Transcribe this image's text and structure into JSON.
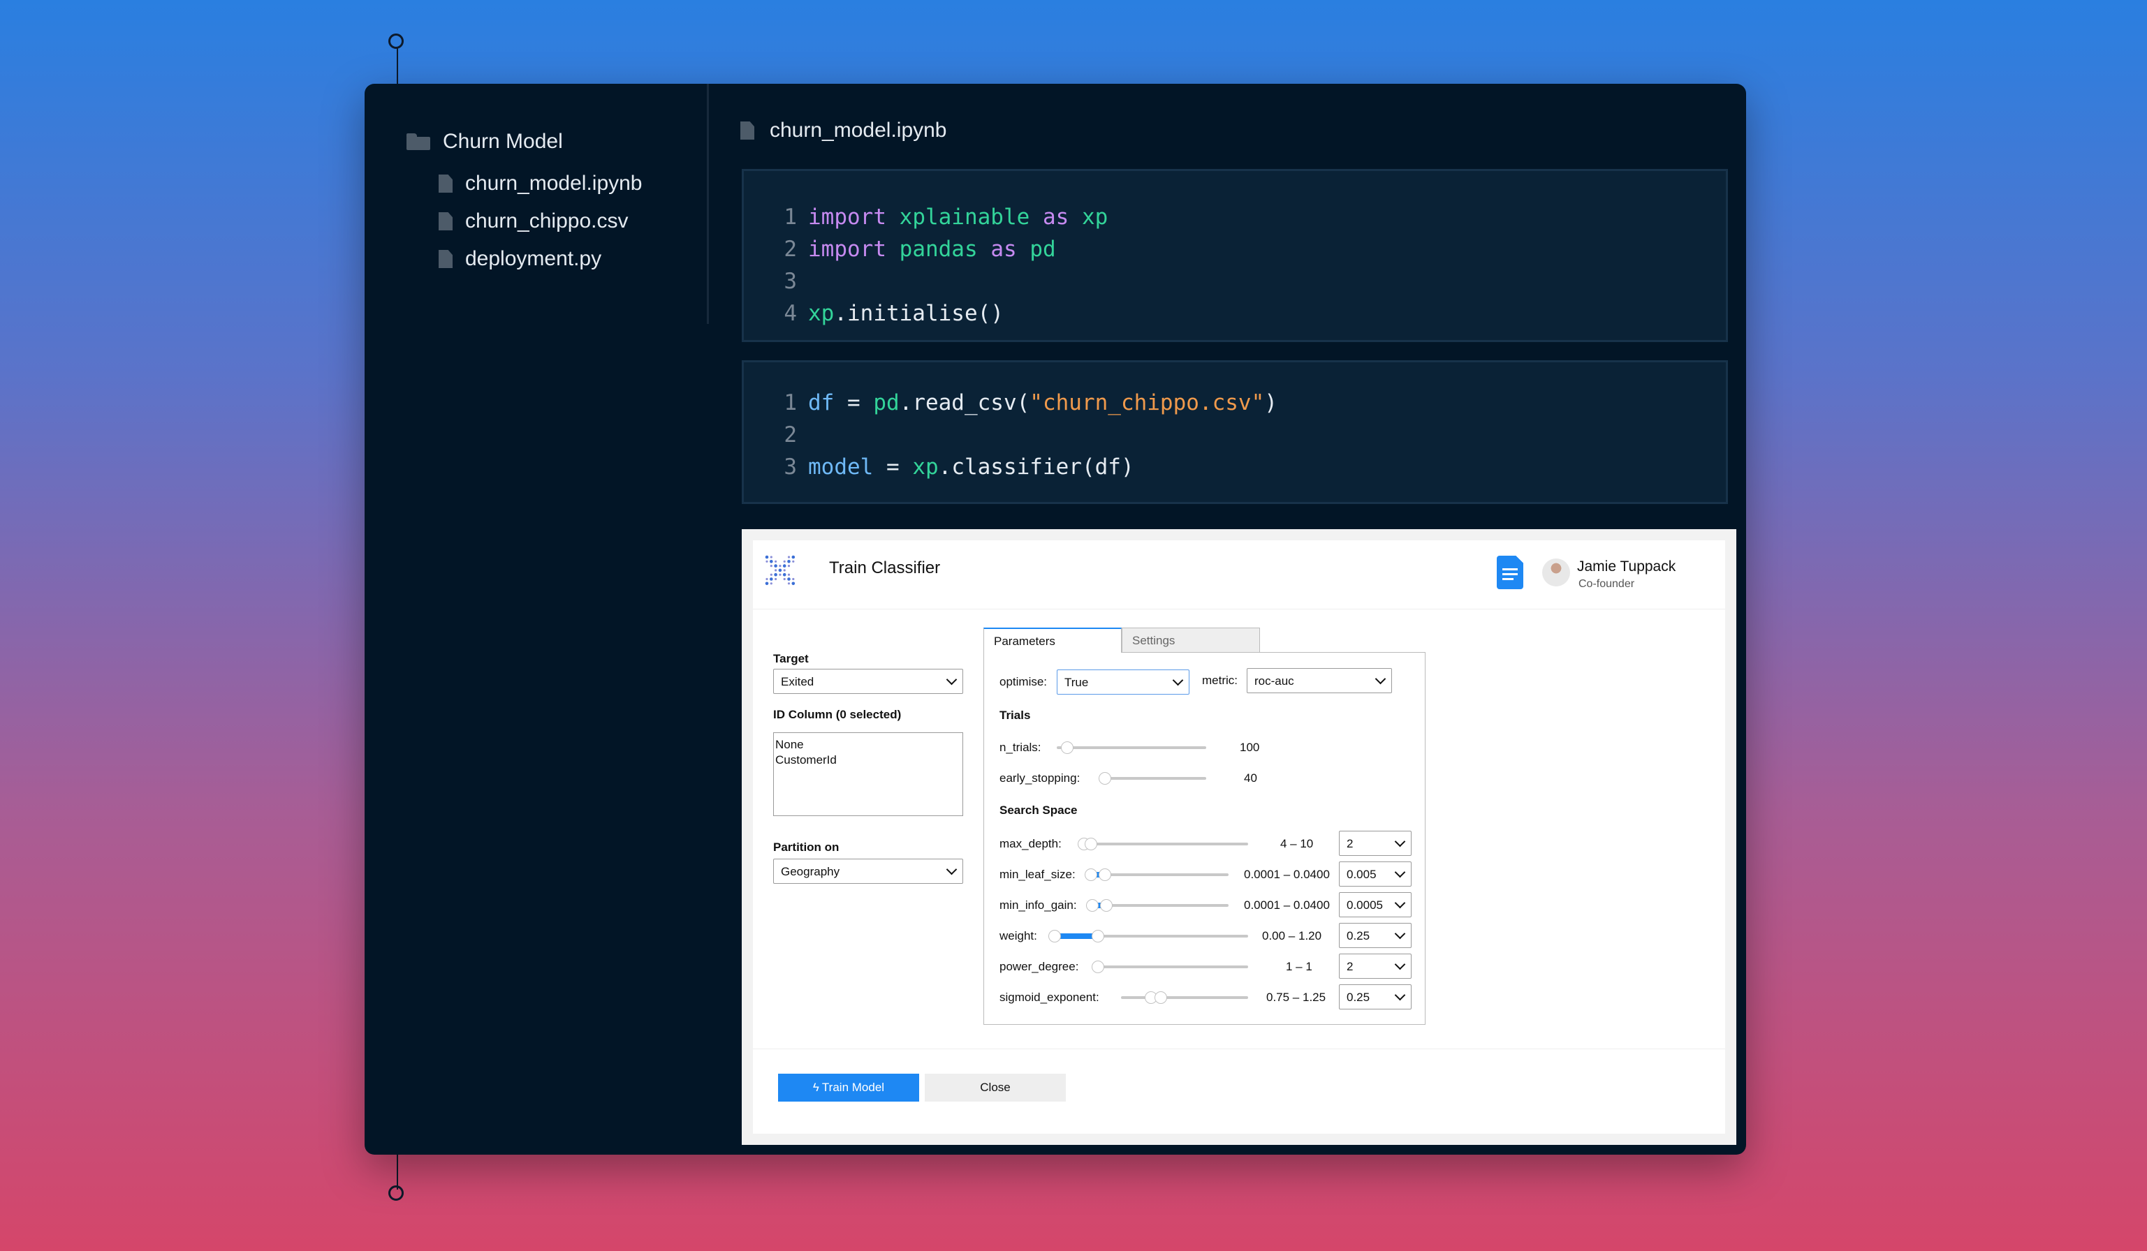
{
  "sidebar": {
    "folder": "Churn Model",
    "files": [
      "churn_model.ipynb",
      "churn_chippo.csv",
      "deployment.py"
    ]
  },
  "main": {
    "open_file": "churn_model.ipynb"
  },
  "cells": [
    {
      "lines": [
        {
          "n": "1",
          "tokens": [
            {
              "t": "import",
              "c": "kw"
            },
            {
              "t": " ",
              "c": "op"
            },
            {
              "t": "xplainable",
              "c": "mod"
            },
            {
              "t": " ",
              "c": "op"
            },
            {
              "t": "as",
              "c": "kw"
            },
            {
              "t": " ",
              "c": "op"
            },
            {
              "t": "xp",
              "c": "mod"
            }
          ]
        },
        {
          "n": "2",
          "tokens": [
            {
              "t": "import",
              "c": "kw"
            },
            {
              "t": " ",
              "c": "op"
            },
            {
              "t": "pandas",
              "c": "mod"
            },
            {
              "t": " ",
              "c": "op"
            },
            {
              "t": "as",
              "c": "kw"
            },
            {
              "t": " ",
              "c": "op"
            },
            {
              "t": "pd",
              "c": "mod"
            }
          ]
        },
        {
          "n": "3",
          "tokens": []
        },
        {
          "n": "4",
          "tokens": [
            {
              "t": "xp",
              "c": "mod"
            },
            {
              "t": ".initialise()",
              "c": "fn"
            }
          ]
        }
      ]
    },
    {
      "lines": [
        {
          "n": "1",
          "tokens": [
            {
              "t": "df",
              "c": "var"
            },
            {
              "t": " = ",
              "c": "op"
            },
            {
              "t": "pd",
              "c": "mod"
            },
            {
              "t": ".read_csv(",
              "c": "fn"
            },
            {
              "t": "\"churn_chippo.csv\"",
              "c": "str"
            },
            {
              "t": ")",
              "c": "fn"
            }
          ]
        },
        {
          "n": "2",
          "tokens": []
        },
        {
          "n": "3",
          "tokens": [
            {
              "t": "model",
              "c": "var"
            },
            {
              "t": " = ",
              "c": "op"
            },
            {
              "t": "xp",
              "c": "mod"
            },
            {
              "t": ".classifier(df)",
              "c": "fn"
            }
          ]
        }
      ]
    }
  ],
  "widget": {
    "title": "Train Classifier",
    "user": {
      "name": "Jamie Tuppack",
      "role": "Co-founder"
    },
    "target": {
      "label": "Target",
      "value": "Exited"
    },
    "id_column": {
      "label": "ID Column (0 selected)",
      "options": [
        "None",
        "CustomerId"
      ]
    },
    "partition": {
      "label": "Partition on",
      "value": "Geography"
    },
    "tabs": [
      "Parameters",
      "Settings"
    ],
    "optimise": {
      "label": "optimise:",
      "value": "True"
    },
    "metric": {
      "label": "metric:",
      "value": "roc-auc"
    },
    "trials": {
      "heading": "Trials",
      "n_trials": {
        "label": "n_trials:",
        "value": "100"
      },
      "early_stopping": {
        "label": "early_stopping:",
        "value": "40"
      }
    },
    "search_space": {
      "heading": "Search Space",
      "params": [
        {
          "label": "max_depth:",
          "range": "4 – 10",
          "step": "2"
        },
        {
          "label": "min_leaf_size:",
          "range": "0.0001 – 0.0400",
          "step": "0.005"
        },
        {
          "label": "min_info_gain:",
          "range": "0.0001 – 0.0400",
          "step": "0.0005"
        },
        {
          "label": "weight:",
          "range": "0.00 – 1.20",
          "step": "0.25"
        },
        {
          "label": "power_degree:",
          "range": "1 – 1",
          "step": "2"
        },
        {
          "label": "sigmoid_exponent:",
          "range": "0.75 – 1.25",
          "step": "0.25"
        }
      ]
    },
    "buttons": {
      "train": "Train Model",
      "close": "Close"
    }
  },
  "colors": {
    "accent": "#1e88f3",
    "window_bg": "#021526",
    "cell_bg": "#0a2236"
  }
}
